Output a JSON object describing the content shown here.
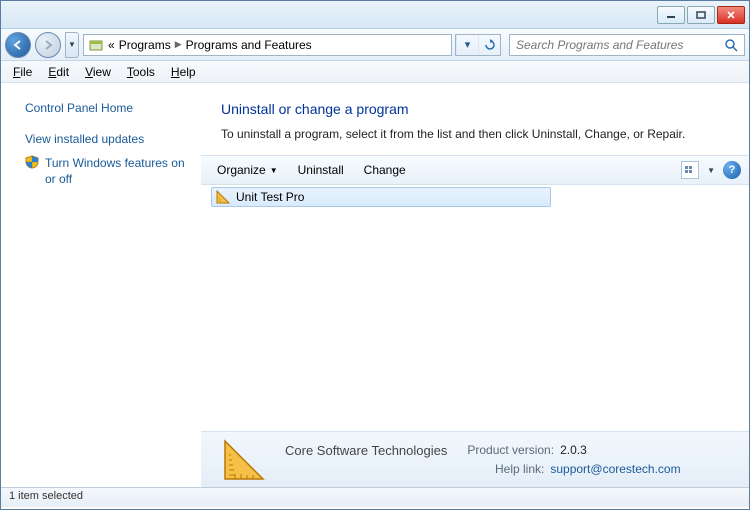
{
  "breadcrumb": {
    "prefix": "«",
    "level1": "Programs",
    "level2": "Programs and Features"
  },
  "search": {
    "placeholder": "Search Programs and Features"
  },
  "menu": {
    "file": "File",
    "edit": "Edit",
    "view": "View",
    "tools": "Tools",
    "help": "Help"
  },
  "sidebar": {
    "cph": "Control Panel Home",
    "viu": "View installed updates",
    "winfeat": "Turn Windows features on or off"
  },
  "content": {
    "heading": "Uninstall or change a program",
    "subtext": "To uninstall a program, select it from the list and then click Uninstall, Change, or Repair."
  },
  "toolbar": {
    "organize": "Organize",
    "uninstall": "Uninstall",
    "change": "Change"
  },
  "list": {
    "item0": "Unit Test Pro"
  },
  "details": {
    "company": "Core Software Technologies",
    "pv_label": "Product version:",
    "pv_value": "2.0.3",
    "hl_label": "Help link:",
    "hl_value": "support@corestech.com"
  },
  "status": {
    "text": "1 item selected"
  }
}
